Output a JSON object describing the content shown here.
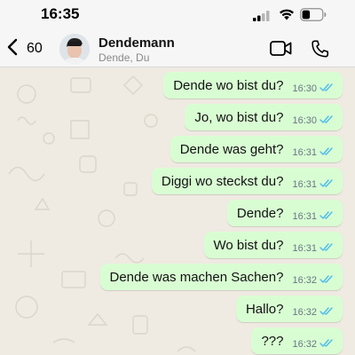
{
  "status_bar": {
    "time": "16:35"
  },
  "header": {
    "back_count": "60",
    "contact_name": "Dendemann",
    "contact_subtitle": "Dende, Du"
  },
  "messages": [
    {
      "text": "Dende wo bist du?",
      "time": "16:30",
      "status": "read"
    },
    {
      "text": "Jo, wo bist du?",
      "time": "16:30",
      "status": "read"
    },
    {
      "text": "Dende was geht?",
      "time": "16:31",
      "status": "read"
    },
    {
      "text": "Diggi wo steckst du?",
      "time": "16:31",
      "status": "read"
    },
    {
      "text": "Dende?",
      "time": "16:31",
      "status": "read"
    },
    {
      "text": "Wo bist du?",
      "time": "16:31",
      "status": "read"
    },
    {
      "text": "Dende was machen Sachen?",
      "time": "16:32",
      "status": "read"
    },
    {
      "text": "Hallo?",
      "time": "16:32",
      "status": "read"
    },
    {
      "text": "???",
      "time": "16:32",
      "status": "read"
    }
  ],
  "colors": {
    "outgoing_bubble": "#d9fdd3",
    "read_ticks": "#53bdeb",
    "chat_background": "#efeae2"
  }
}
